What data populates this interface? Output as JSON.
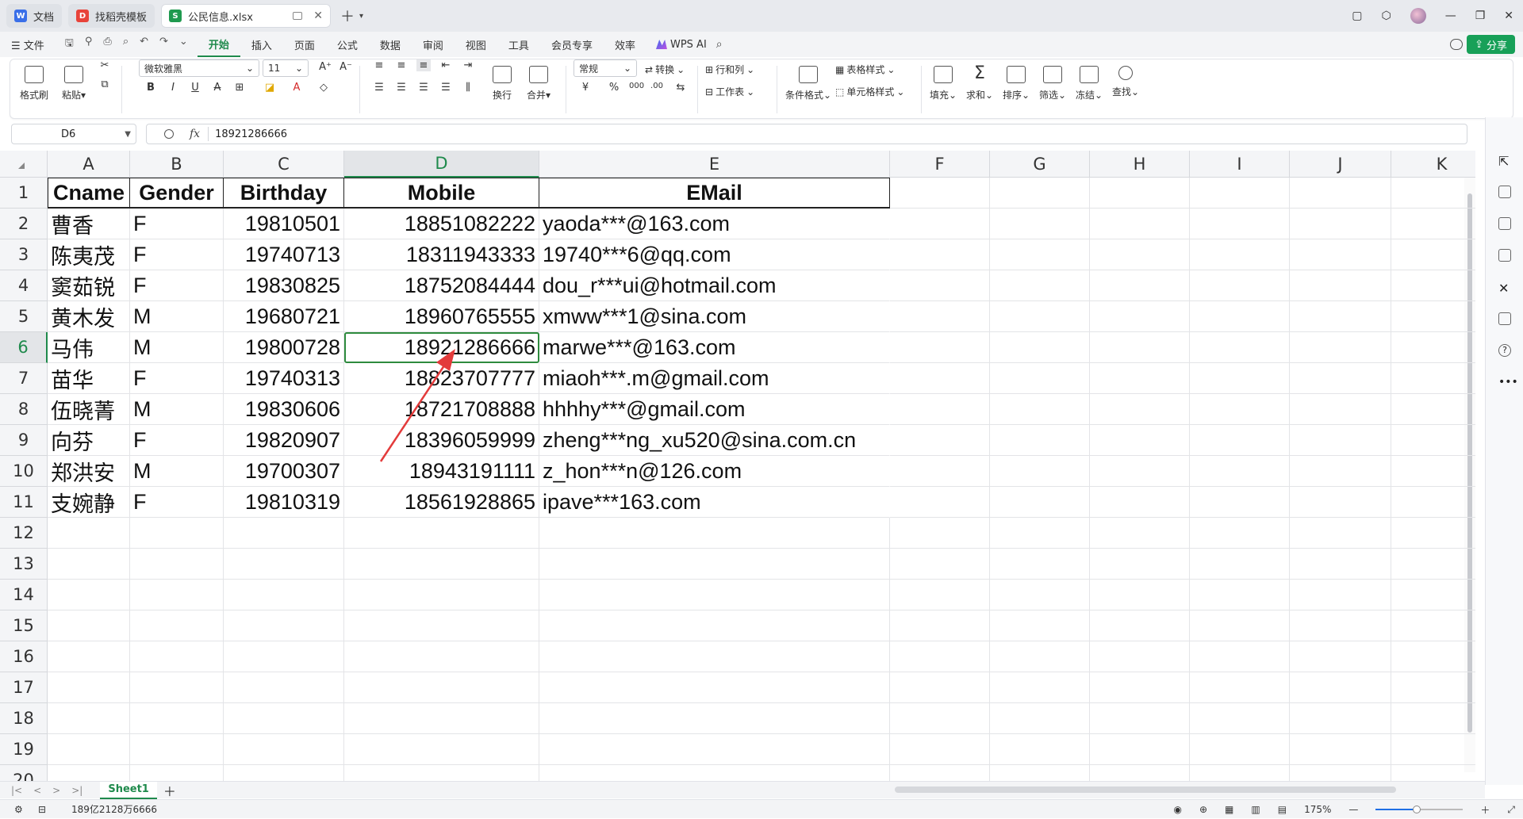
{
  "tabs": [
    {
      "label": "文档",
      "color": "#3a6fe8",
      "glyph": "W"
    },
    {
      "label": "找稻壳模板",
      "color": "#e8433a",
      "glyph": "D"
    },
    {
      "label": "公民信息.xlsx",
      "color": "#1f9a4f",
      "glyph": "S",
      "active": true
    }
  ],
  "menu": {
    "file": "☰ 文件",
    "items": [
      "开始",
      "插入",
      "页面",
      "公式",
      "数据",
      "审阅",
      "视图",
      "工具",
      "会员专享",
      "效率"
    ],
    "active": "开始",
    "wps_ai": "WPS AI",
    "share": "分享"
  },
  "ribbon": {
    "format_painter": "格式刷",
    "paste": "粘贴",
    "font_name": "微软雅黑",
    "font_size": "11",
    "number_format": "常规",
    "convert": "转换",
    "rows_cols": "行和列",
    "wrap": "换行",
    "merge": "合并",
    "worksheet": "工作表",
    "cond_format": "条件格式",
    "table_style": "表格样式",
    "cell_style": "单元格样式",
    "fill": "填充",
    "sum": "求和",
    "sort": "排序",
    "filter": "筛选",
    "freeze": "冻结",
    "find": "查找"
  },
  "formula_bar": {
    "name_box": "D6",
    "fx": "fx",
    "value": "18921286666"
  },
  "columns": [
    "A",
    "B",
    "C",
    "D",
    "E",
    "F",
    "G",
    "H",
    "I",
    "J",
    "K"
  ],
  "active_column": "D",
  "active_row": 6,
  "rows": [
    "1",
    "2",
    "3",
    "4",
    "5",
    "6",
    "7",
    "8",
    "9",
    "10",
    "11",
    "12",
    "13",
    "14",
    "15",
    "16",
    "17",
    "18",
    "19",
    "20"
  ],
  "table": {
    "headers": [
      "Cname",
      "Gender",
      "Birthday",
      "Mobile",
      "EMail"
    ],
    "data": [
      [
        "曹香",
        "F",
        "19810501",
        "18851082222",
        "yaoda***@163.com"
      ],
      [
        "陈夷茂",
        "F",
        "19740713",
        "18311943333",
        "19740***6@qq.com"
      ],
      [
        "窦茹锐",
        "F",
        "19830825",
        "18752084444",
        "dou_r***ui@hotmail.com"
      ],
      [
        "黄木发",
        "M",
        "19680721",
        "18960765555",
        "xmww***1@sina.com"
      ],
      [
        "马伟",
        "M",
        "19800728",
        "18921286666",
        "marwe***@163.com"
      ],
      [
        "苗华",
        "F",
        "19740313",
        "18823707777",
        "miaoh***.m@gmail.com"
      ],
      [
        "伍晓菁",
        "M",
        "19830606",
        "18721708888",
        "hhhhy***@gmail.com"
      ],
      [
        "向芬",
        "F",
        "19820907",
        "18396059999",
        "zheng***ng_xu520@sina.com.cn"
      ],
      [
        "郑洪安",
        "M",
        "19700307",
        "18943191111",
        "z_hon***n@126.com"
      ],
      [
        "支婉静",
        "F",
        "19810319",
        "18561928865",
        "ipave***163.com"
      ]
    ]
  },
  "sheets": [
    "Sheet1"
  ],
  "status": {
    "summary": "189亿2128万6666",
    "zoom": "175%",
    "zoom_level_fraction": 0.47
  }
}
